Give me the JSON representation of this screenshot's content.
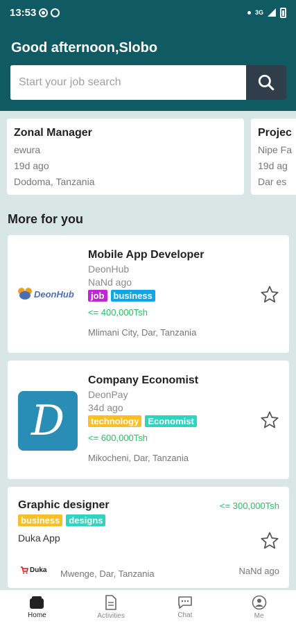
{
  "status_bar": {
    "time": "13:53",
    "network": "3G"
  },
  "header": {
    "greeting": "Good afternoon,Slobo"
  },
  "search": {
    "placeholder": "Start your job search"
  },
  "recent_jobs": [
    {
      "title": "Zonal Manager",
      "company": "ewura",
      "age": "19d ago",
      "location": "Dodoma, Tanzania"
    },
    {
      "title": "Projec",
      "company": "Nipe Fa",
      "age": "19d ag",
      "location": "Dar es"
    }
  ],
  "section_title": "More for you",
  "jobs": [
    {
      "title": "Mobile App Developer",
      "company": "DeonHub",
      "age": "NaNd ago",
      "tags": [
        "job",
        "business"
      ],
      "salary": "<= 400,000Tsh",
      "location": "Mlimani City, Dar, Tanzania",
      "logo_text": "DeonHub"
    },
    {
      "title": "Company Economist",
      "company": "DeonPay",
      "age": "34d ago",
      "tags": [
        "technology",
        "Economist"
      ],
      "salary": "<= 600,000Tsh",
      "location": "Mikocheni, Dar, Tanzania",
      "logo_text": "D"
    },
    {
      "title": "Graphic designer",
      "company": "Duka App",
      "age": "NaNd ago",
      "tags": [
        "business",
        "designs"
      ],
      "salary": "<= 300,000Tsh",
      "location": "Mwenge, Dar, Tanzania",
      "logo_text": "Duka"
    }
  ],
  "nav": [
    {
      "label": "Home",
      "icon": "home-icon"
    },
    {
      "label": "Activities",
      "icon": "document-icon"
    },
    {
      "label": "Chat",
      "icon": "chat-icon"
    },
    {
      "label": "Me",
      "icon": "user-icon"
    }
  ],
  "colors": {
    "header": "#105b63",
    "search_button": "#2f3e4a",
    "salary": "#22c55e",
    "tag_job": "#c026d3",
    "tag_business_blue": "#0ea5e9",
    "tag_orange": "#fbbf24",
    "tag_teal": "#2dd4bf",
    "deonpay_logo": "#2a8db5"
  }
}
